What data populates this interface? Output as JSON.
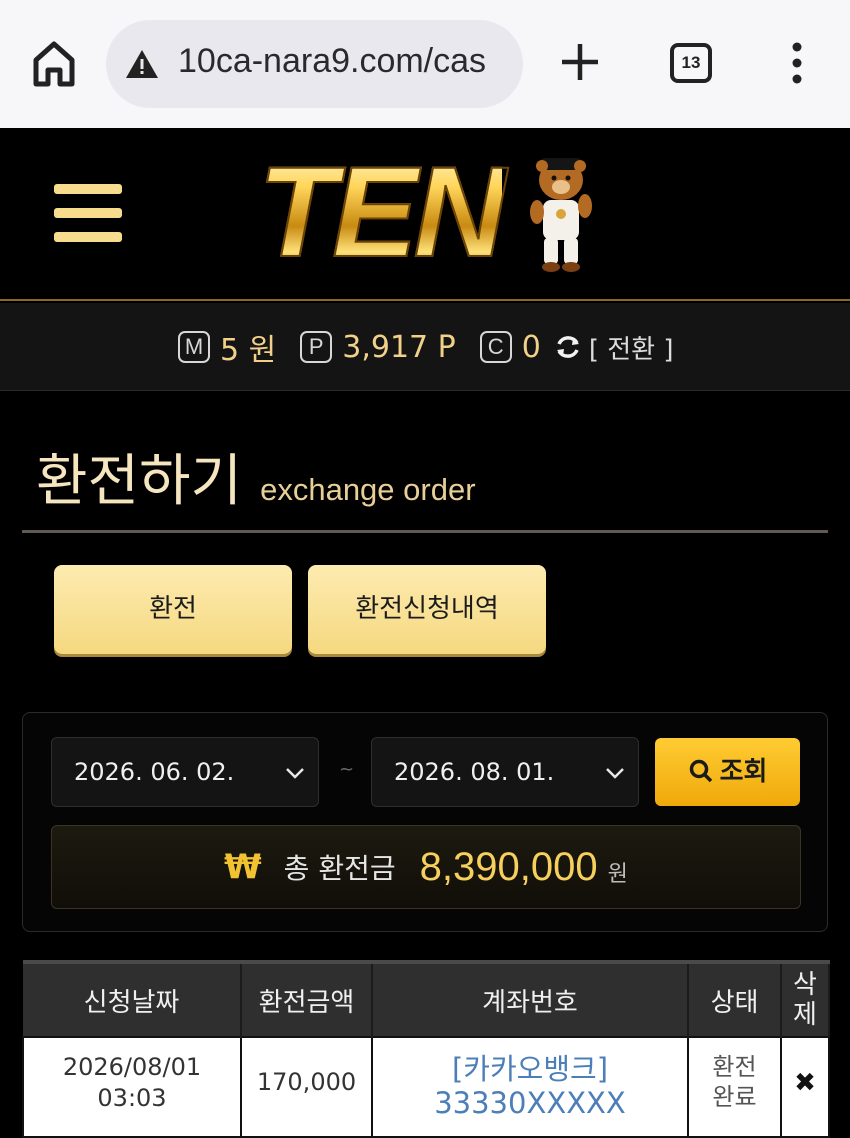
{
  "browser": {
    "url": "10ca-nara9.com/cas",
    "tab_count": "13"
  },
  "header": {
    "logo_text": "TEN"
  },
  "balance": {
    "money_icon": "M",
    "money_value": "5 원",
    "point_icon": "P",
    "point_value": "3,917 P",
    "coin_icon": "C",
    "coin_value": "0",
    "exchange_label": "[ 전환 ]"
  },
  "page": {
    "title_ko": "환전하기",
    "title_en": "exchange order"
  },
  "tabs": {
    "exchange": "환전",
    "history": "환전신청내역"
  },
  "search": {
    "from_date": "2026. 06. 02.",
    "separator": "~",
    "to_date": "2026. 08. 01.",
    "button_label": "조회"
  },
  "total": {
    "currency_symbol": "₩",
    "label": "총 환전금",
    "amount": "8,390,000",
    "unit": "원"
  },
  "table": {
    "headers": {
      "date": "신청날짜",
      "amount": "환전금액",
      "account": "계좌번호",
      "status": "상태",
      "delete_line1": "삭",
      "delete_line2": "제"
    },
    "rows": [
      {
        "date_line1": "2026/08/01",
        "date_line2": "03:03",
        "amount": "170,000",
        "account_line1": "[카카오뱅크]",
        "account_line2": "33330XXXXX",
        "status_line1": "환전",
        "status_line2": "완료",
        "delete_icon": "✖"
      }
    ]
  },
  "colors": {
    "gold": "#f7cf5c",
    "tab_button": "#f5d880",
    "search_button": "#f0a90a",
    "account_link": "#4c7fb8"
  },
  "icons": [
    "home-icon",
    "warning-icon",
    "plus-icon",
    "tabs-icon",
    "more-vert-icon",
    "hamburger-icon",
    "refresh-icon",
    "chevron-down-icon",
    "search-icon",
    "delete-icon"
  ]
}
